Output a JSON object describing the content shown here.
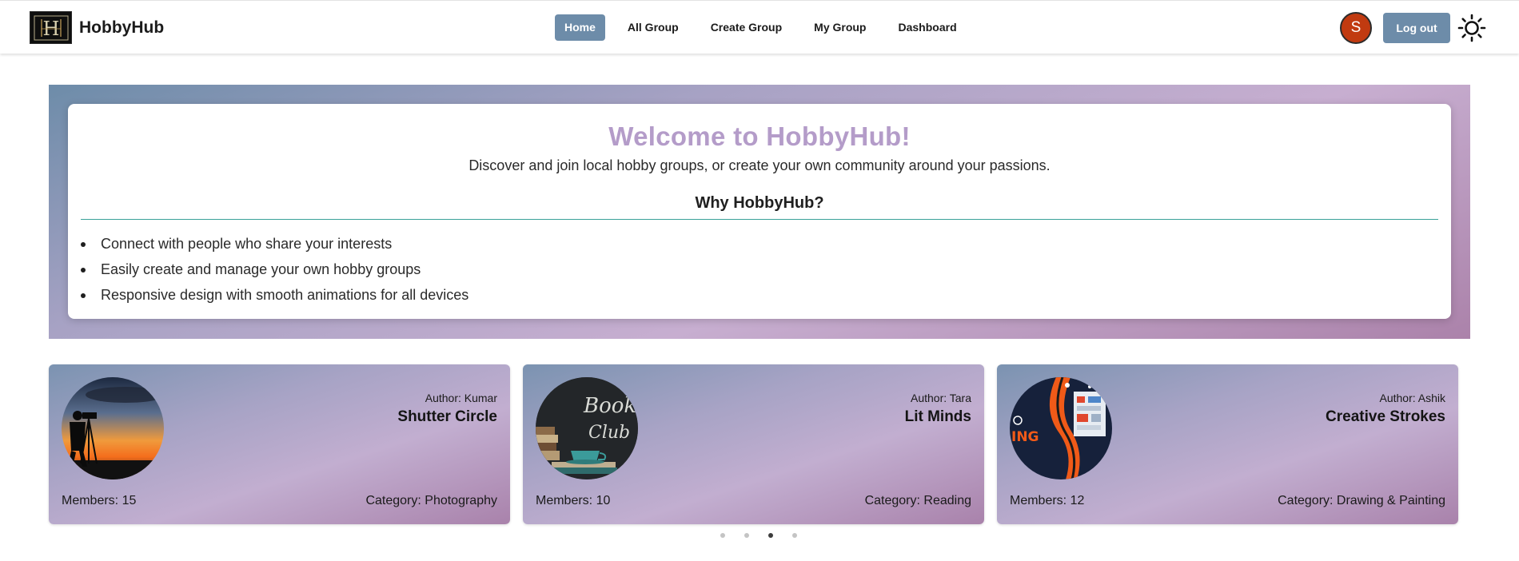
{
  "navbar": {
    "brand_name": "HobbyHub",
    "links": [
      {
        "label": "Home",
        "active": true
      },
      {
        "label": "All Group",
        "active": false
      },
      {
        "label": "Create Group",
        "active": false
      },
      {
        "label": "My Group",
        "active": false
      },
      {
        "label": "Dashboard",
        "active": false
      }
    ],
    "avatar_initial": "S",
    "logout_label": "Log out",
    "theme_icon": "sun-icon"
  },
  "hero": {
    "title": "Welcome to HobbyHub!",
    "subtitle": "Discover and join local hobby groups, or create your own community around your passions.",
    "why_title": "Why HobbyHub?",
    "features": [
      "Connect with people who share your interests",
      "Easily create and manage your own hobby groups",
      "Responsive design with smooth animations for all devices"
    ]
  },
  "groups": [
    {
      "author": "Author: Kumar",
      "name": "Shutter Circle",
      "members": "Members: 15",
      "category": "Category: Photography"
    },
    {
      "author": "Author: Tara",
      "name": "Lit Minds",
      "members": "Members: 10",
      "category": "Category: Reading"
    },
    {
      "author": "Author: Ashik",
      "name": "Creative Strokes",
      "members": "Members: 12",
      "category": "Category: Drawing & Painting"
    }
  ],
  "carousel": {
    "slide_count": 4,
    "active_index": 2
  },
  "colors": {
    "accent": "#6d8ca9",
    "title": "#b49cc9",
    "avatar": "#c13a10",
    "divider": "#3aa198"
  }
}
